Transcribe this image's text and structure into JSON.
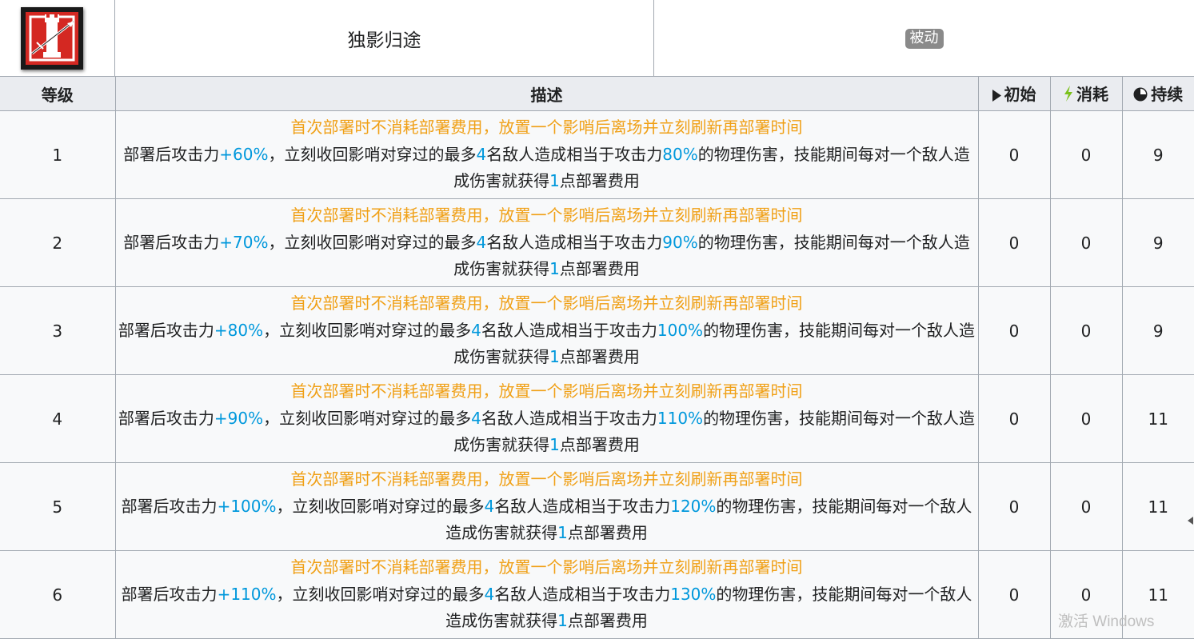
{
  "skill": {
    "name": "独影归途",
    "type_badge": "被动",
    "icon": "skill-icon",
    "icon_colors": {
      "background": "#d42822",
      "border": "#1a1a1a",
      "symbol": "#ffffff"
    }
  },
  "headers": {
    "level": "等级",
    "description": "描述",
    "initial": "初始",
    "initial_icon": "play-icon",
    "cost": "消耗",
    "cost_icon": "lightning-icon",
    "duration": "持续",
    "duration_icon": "clock-icon"
  },
  "colors": {
    "condition_text": "#f0a016",
    "highlight_number": "#0098dc",
    "lightning": "#7bc11b",
    "header_bg": "#eaecf0",
    "cell_bg": "#f8f9fa",
    "badge_bg": "#8a8a8a"
  },
  "rows": [
    {
      "level": "1",
      "cond": "首次部署时不消耗部署费用，放置一个影哨后离场并立刻刷新再部署时间",
      "d1": "部署后攻击力",
      "atk": "+60%",
      "d2": "，立刻收回影哨对穿过的最多",
      "n": "4",
      "d3": "名敌人造成相当于攻击力",
      "dmg": "80%",
      "d4": "的物理伤害，技能期间每对一个敌人造成伤害就获得",
      "pts": "1",
      "d5": "点部署费用",
      "initial": "0",
      "cost": "0",
      "duration": "9"
    },
    {
      "level": "2",
      "cond": "首次部署时不消耗部署费用，放置一个影哨后离场并立刻刷新再部署时间",
      "d1": "部署后攻击力",
      "atk": "+70%",
      "d2": "，立刻收回影哨对穿过的最多",
      "n": "4",
      "d3": "名敌人造成相当于攻击力",
      "dmg": "90%",
      "d4": "的物理伤害，技能期间每对一个敌人造成伤害就获得",
      "pts": "1",
      "d5": "点部署费用",
      "initial": "0",
      "cost": "0",
      "duration": "9"
    },
    {
      "level": "3",
      "cond": "首次部署时不消耗部署费用，放置一个影哨后离场并立刻刷新再部署时间",
      "d1": "部署后攻击力",
      "atk": "+80%",
      "d2": "，立刻收回影哨对穿过的最多",
      "n": "4",
      "d3": "名敌人造成相当于攻击力",
      "dmg": "100%",
      "d4": "的物理伤害，技能期间每对一个敌人造成伤害就获得",
      "pts": "1",
      "d5": "点部署费用",
      "initial": "0",
      "cost": "0",
      "duration": "9"
    },
    {
      "level": "4",
      "cond": "首次部署时不消耗部署费用，放置一个影哨后离场并立刻刷新再部署时间",
      "d1": "部署后攻击力",
      "atk": "+90%",
      "d2": "，立刻收回影哨对穿过的最多",
      "n": "4",
      "d3": "名敌人造成相当于攻击力",
      "dmg": "110%",
      "d4": "的物理伤害，技能期间每对一个敌人造成伤害就获得",
      "pts": "1",
      "d5": "点部署费用",
      "initial": "0",
      "cost": "0",
      "duration": "11"
    },
    {
      "level": "5",
      "cond": "首次部署时不消耗部署费用，放置一个影哨后离场并立刻刷新再部署时间",
      "d1": "部署后攻击力",
      "atk": "+100%",
      "d2": "，立刻收回影哨对穿过的最多",
      "n": "4",
      "d3": "名敌人造成相当于攻击力",
      "dmg": "120%",
      "d4": "的物理伤害，技能期间每对一个敌人造成伤害就获得",
      "pts": "1",
      "d5": "点部署费用",
      "initial": "0",
      "cost": "0",
      "duration": "11"
    },
    {
      "level": "6",
      "cond": "首次部署时不消耗部署费用，放置一个影哨后离场并立刻刷新再部署时间",
      "d1": "部署后攻击力",
      "atk": "+110%",
      "d2": "，立刻收回影哨对穿过的最多",
      "n": "4",
      "d3": "名敌人造成相当于攻击力",
      "dmg": "130%",
      "d4": "的物理伤害，技能期间每对一个敌人造成伤害就获得",
      "pts": "1",
      "d5": "点部署费用",
      "initial": "0",
      "cost": "0",
      "duration": "11"
    }
  ],
  "watermark": "激活 Windows"
}
